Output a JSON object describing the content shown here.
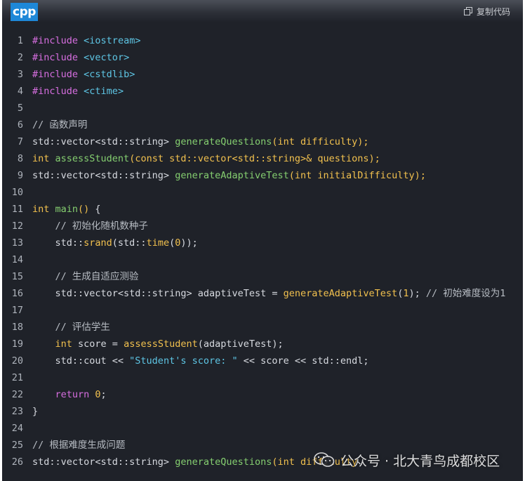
{
  "header": {
    "language": "cpp",
    "copy_label": "复制代码"
  },
  "watermark": {
    "text": "公众号 · 北大青鸟成都校区"
  },
  "code_lines": [
    {
      "num": "1",
      "tokens": [
        {
          "t": "#include",
          "c": "pp"
        },
        {
          "t": " ",
          "c": "pl"
        },
        {
          "t": "<iostream>",
          "c": "hdr"
        }
      ]
    },
    {
      "num": "2",
      "tokens": [
        {
          "t": "#include",
          "c": "pp"
        },
        {
          "t": " ",
          "c": "pl"
        },
        {
          "t": "<vector>",
          "c": "hdr"
        }
      ]
    },
    {
      "num": "3",
      "tokens": [
        {
          "t": "#include",
          "c": "pp"
        },
        {
          "t": " ",
          "c": "pl"
        },
        {
          "t": "<cstdlib>",
          "c": "hdr"
        }
      ]
    },
    {
      "num": "4",
      "tokens": [
        {
          "t": "#include",
          "c": "pp"
        },
        {
          "t": " ",
          "c": "pl"
        },
        {
          "t": "<ctime>",
          "c": "hdr"
        }
      ]
    },
    {
      "num": "5",
      "tokens": []
    },
    {
      "num": "6",
      "tokens": [
        {
          "t": "// 函数声明",
          "c": "cm"
        }
      ]
    },
    {
      "num": "7",
      "tokens": [
        {
          "t": "std::vector<std::string> ",
          "c": "pl"
        },
        {
          "t": "generateQuestions",
          "c": "fn"
        },
        {
          "t": "(int difficulty);",
          "c": "kw"
        }
      ]
    },
    {
      "num": "8",
      "tokens": [
        {
          "t": "int ",
          "c": "kw"
        },
        {
          "t": "assessStudent",
          "c": "fn"
        },
        {
          "t": "(const std::vector<std::string>& questions);",
          "c": "kw"
        }
      ]
    },
    {
      "num": "9",
      "tokens": [
        {
          "t": "std::vector<std::string> ",
          "c": "pl"
        },
        {
          "t": "generateAdaptiveTest",
          "c": "fn"
        },
        {
          "t": "(int initialDifficulty);",
          "c": "kw"
        }
      ]
    },
    {
      "num": "10",
      "tokens": []
    },
    {
      "num": "11",
      "tokens": [
        {
          "t": "int ",
          "c": "kw"
        },
        {
          "t": "main",
          "c": "fn"
        },
        {
          "t": "()",
          "c": "par"
        },
        {
          "t": " {",
          "c": "pl"
        }
      ]
    },
    {
      "num": "12",
      "tokens": [
        {
          "t": "    // 初始化随机数种子",
          "c": "cm"
        }
      ]
    },
    {
      "num": "13",
      "tokens": [
        {
          "t": "    std::",
          "c": "pl"
        },
        {
          "t": "srand",
          "c": "fn2"
        },
        {
          "t": "(std::",
          "c": "pl"
        },
        {
          "t": "time",
          "c": "fn2"
        },
        {
          "t": "(",
          "c": "pl"
        },
        {
          "t": "0",
          "c": "num"
        },
        {
          "t": "));",
          "c": "pl"
        }
      ]
    },
    {
      "num": "14",
      "tokens": []
    },
    {
      "num": "15",
      "tokens": [
        {
          "t": "    // 生成自适应测验",
          "c": "cm"
        }
      ]
    },
    {
      "num": "16",
      "tokens": [
        {
          "t": "    std::vector<std::string> adaptiveTest = ",
          "c": "pl"
        },
        {
          "t": "generateAdaptiveTest",
          "c": "fn2"
        },
        {
          "t": "(",
          "c": "pl"
        },
        {
          "t": "1",
          "c": "num"
        },
        {
          "t": "); ",
          "c": "pl"
        },
        {
          "t": "// 初始难度设为1",
          "c": "cm"
        }
      ]
    },
    {
      "num": "17",
      "tokens": []
    },
    {
      "num": "18",
      "tokens": [
        {
          "t": "    // 评估学生",
          "c": "cm"
        }
      ]
    },
    {
      "num": "19",
      "tokens": [
        {
          "t": "    int ",
          "c": "kw"
        },
        {
          "t": "score = ",
          "c": "pl"
        },
        {
          "t": "assessStudent",
          "c": "fn2"
        },
        {
          "t": "(adaptiveTest);",
          "c": "pl"
        }
      ]
    },
    {
      "num": "20",
      "tokens": [
        {
          "t": "    std::cout << ",
          "c": "pl"
        },
        {
          "t": "\"Student's score: \"",
          "c": "str"
        },
        {
          "t": " << score << std::endl;",
          "c": "pl"
        }
      ]
    },
    {
      "num": "21",
      "tokens": []
    },
    {
      "num": "22",
      "tokens": [
        {
          "t": "    return ",
          "c": "ret"
        },
        {
          "t": "0",
          "c": "num"
        },
        {
          "t": ";",
          "c": "pl"
        }
      ]
    },
    {
      "num": "23",
      "tokens": [
        {
          "t": "}",
          "c": "pl"
        }
      ]
    },
    {
      "num": "24",
      "tokens": []
    },
    {
      "num": "25",
      "tokens": [
        {
          "t": "// 根据难度生成问题",
          "c": "cm"
        }
      ]
    },
    {
      "num": "26",
      "tokens": [
        {
          "t": "std::vector<std::string> ",
          "c": "pl"
        },
        {
          "t": "generateQuestions",
          "c": "fn"
        },
        {
          "t": "(int difficulty",
          "c": "kw"
        }
      ]
    }
  ],
  "colors": {
    "background": "#1f2229",
    "badge": "#1e88d8",
    "keyword": "#f2c14e",
    "function": "#85cf70",
    "header": "#5ec6e5",
    "preprocessor": "#d76ee0",
    "comment": "#b7bcc3"
  },
  "icons": {
    "copy": "copy-icon",
    "watermark": "wechat-icon"
  }
}
